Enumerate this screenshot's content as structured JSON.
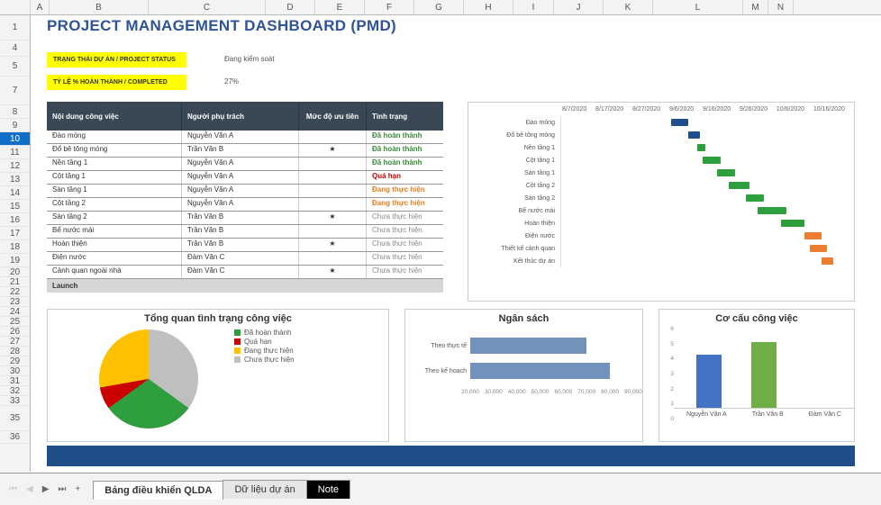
{
  "title": "PROJECT MANAGEMENT DASHBOARD (PMD)",
  "columns": [
    "A",
    "B",
    "C",
    "D",
    "E",
    "F",
    "G",
    "H",
    "I",
    "J",
    "K",
    "L",
    "M",
    "N"
  ],
  "rows_visible": [
    "1",
    "4",
    "5",
    "7",
    "8",
    "9",
    "10",
    "11",
    "12",
    "13",
    "14",
    "15",
    "16",
    "17",
    "18",
    "19",
    "20",
    "21",
    "22",
    "23",
    "24",
    "25",
    "26",
    "27",
    "28",
    "29",
    "30",
    "31",
    "32",
    "33",
    "35",
    "36"
  ],
  "selected_row": "10",
  "status": {
    "label1": "TRẠNG THÁI DỰ ÁN / PROJECT STATUS",
    "value1": "Đang kiểm soát",
    "label2": "TỶ LỆ % HOÀN THÀNH / COMPLETED",
    "value2": "27%"
  },
  "table": {
    "headers": [
      "Nội dung công việc",
      "Người phụ trách",
      "Mức độ ưu tiên",
      "Tình trạng"
    ],
    "rows": [
      {
        "task": "Đào móng",
        "owner": "Nguyễn Văn A",
        "pri": "",
        "status": "Đã hoàn thành",
        "cls": "st-done"
      },
      {
        "task": "Đổ bê tông móng",
        "owner": "Trần Văn B",
        "pri": "★",
        "status": "Đã hoàn thành",
        "cls": "st-done"
      },
      {
        "task": "Nền tầng 1",
        "owner": "Nguyễn Văn A",
        "pri": "",
        "status": "Đã hoàn thành",
        "cls": "st-done"
      },
      {
        "task": "Cột tầng 1",
        "owner": "Nguyễn Văn A",
        "pri": "",
        "status": "Quá hạn",
        "cls": "st-late"
      },
      {
        "task": "Sàn tầng 1",
        "owner": "Nguyễn Văn A",
        "pri": "",
        "status": "Đang thực hiện",
        "cls": "st-prog"
      },
      {
        "task": "Cột tầng 2",
        "owner": "Nguyễn Văn A",
        "pri": "",
        "status": "Đang thực hiện",
        "cls": "st-prog"
      },
      {
        "task": "Sàn tầng 2",
        "owner": "Trần Văn B",
        "pri": "★",
        "status": "Chưa thực hiện",
        "cls": "st-wait"
      },
      {
        "task": "Bể nước mái",
        "owner": "Trần Văn B",
        "pri": "",
        "status": "Chưa thực hiện",
        "cls": "st-wait"
      },
      {
        "task": "Hoàn thiện",
        "owner": "Trần Văn B",
        "pri": "★",
        "status": "Chưa thực hiện",
        "cls": "st-wait"
      },
      {
        "task": "Điện nước",
        "owner": "Đàm Văn C",
        "pri": "",
        "status": "Chưa thực hiện",
        "cls": "st-wait"
      },
      {
        "task": "Cảnh quan ngoài nhà",
        "owner": "Đàm Văn C",
        "pri": "★",
        "status": "Chưa thực hiện",
        "cls": "st-wait"
      }
    ],
    "launch": "Launch"
  },
  "chart_data": [
    {
      "id": "gantt",
      "type": "bar",
      "title": "",
      "x_dates": [
        "8/7/2020",
        "8/17/2020",
        "8/27/2020",
        "9/6/2020",
        "9/16/2020",
        "9/26/2020",
        "10/6/2020",
        "10/16/2020"
      ],
      "series": [
        {
          "name": "Đào móng",
          "start": 38,
          "dur": 6,
          "color": "g-blue"
        },
        {
          "name": "Đổ bê tông móng",
          "start": 44,
          "dur": 4,
          "color": "g-blue"
        },
        {
          "name": "Nền tầng 1",
          "start": 47,
          "dur": 3,
          "color": "g-green"
        },
        {
          "name": "Cột tầng 1",
          "start": 49,
          "dur": 6,
          "color": "g-green"
        },
        {
          "name": "Sàn tầng 1",
          "start": 54,
          "dur": 6,
          "color": "g-green"
        },
        {
          "name": "Cột tầng 2",
          "start": 58,
          "dur": 7,
          "color": "g-green"
        },
        {
          "name": "Sàn tầng 2",
          "start": 64,
          "dur": 6,
          "color": "g-green"
        },
        {
          "name": "Bể nước mái",
          "start": 68,
          "dur": 10,
          "color": "g-green"
        },
        {
          "name": "Hoàn thiện",
          "start": 76,
          "dur": 8,
          "color": "g-green"
        },
        {
          "name": "Điện nước",
          "start": 84,
          "dur": 6,
          "color": "g-orange"
        },
        {
          "name": "Thiết kế cảnh quan",
          "start": 86,
          "dur": 6,
          "color": "g-orange"
        },
        {
          "name": "Kết thúc dự án",
          "start": 90,
          "dur": 4,
          "color": "g-orange"
        }
      ]
    },
    {
      "id": "pie",
      "type": "pie",
      "title": "Tổng quan tình trạng công việc",
      "legend": [
        {
          "label": "Đã hoàn thành",
          "color": "#2e9e3e"
        },
        {
          "label": "Quá hạn",
          "color": "#c00"
        },
        {
          "label": "Đang thực hiện",
          "color": "#ffc000"
        },
        {
          "label": "Chưa thực hiện",
          "color": "#bfbfbf"
        }
      ],
      "values": {
        "Đã hoàn thành": 30,
        "Quá hạn": 7,
        "Đang thực hiện": 28,
        "Chưa thực hiện": 35
      }
    },
    {
      "id": "budget",
      "type": "bar",
      "orientation": "horizontal",
      "title": "Ngân sách",
      "categories": [
        "Theo thực tế",
        "Theo kế hoạch"
      ],
      "values": [
        70000,
        80000
      ],
      "xlim": [
        20000,
        90000
      ],
      "ticks": [
        "20,000",
        "30,000",
        "40,000",
        "50,000",
        "60,000",
        "70,000",
        "80,000",
        "90,000"
      ]
    },
    {
      "id": "workload",
      "type": "bar",
      "title": "Cơ cấu công việc",
      "categories": [
        "Nguyễn Văn A",
        "Trần Văn B",
        "Đàm Văn C"
      ],
      "values": [
        4,
        5,
        0
      ],
      "ylim": [
        0,
        6
      ],
      "colors": [
        "#4472c4",
        "#70ad47",
        "#ffc000"
      ]
    }
  ],
  "tabs": {
    "items": [
      {
        "label": "Bảng điều khiển QLDA",
        "active": true
      },
      {
        "label": "Dữ liệu dự án",
        "active": false
      },
      {
        "label": "Note",
        "active": false,
        "dark": true
      }
    ],
    "add": "+"
  }
}
